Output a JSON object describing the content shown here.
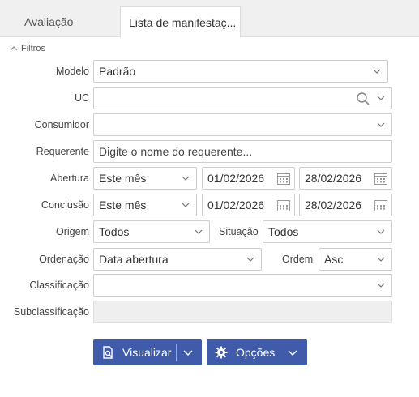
{
  "tabs": [
    {
      "label": "Avaliação"
    },
    {
      "label": "Lista de manifestaç..."
    }
  ],
  "filters": {
    "header": "Filtros",
    "modelo": {
      "label": "Modelo",
      "value": "Padrão"
    },
    "uc": {
      "label": "UC",
      "value": ""
    },
    "consumidor": {
      "label": "Consumidor",
      "value": ""
    },
    "requerente": {
      "label": "Requerente",
      "placeholder": "Digite o nome do requerente..."
    },
    "abertura": {
      "label": "Abertura",
      "period": "Este mês",
      "start": "01/02/2026",
      "end": "28/02/2026"
    },
    "conclusao": {
      "label": "Conclusão",
      "period": "Este mês",
      "start": "01/02/2026",
      "end": "28/02/2026"
    },
    "origem": {
      "label": "Origem",
      "value": "Todos"
    },
    "situacao": {
      "label": "Situação",
      "value": "Todos"
    },
    "ordenacao": {
      "label": "Ordenação",
      "value": "Data abertura"
    },
    "ordem": {
      "label": "Ordem",
      "value": "Asc"
    },
    "classificacao": {
      "label": "Classificação",
      "value": ""
    },
    "subclassificacao": {
      "label": "Subclassificação",
      "value": ""
    }
  },
  "buttons": {
    "visualizar": "Visualizar",
    "opcoes": "Opções"
  },
  "colors": {
    "primary": "#3f5ba9",
    "tabbar_bg": "#f0f0f0",
    "border": "#cfcfcf"
  }
}
